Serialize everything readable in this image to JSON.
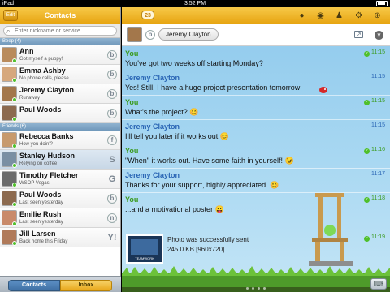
{
  "statusbar": {
    "device": "iPad",
    "time": "3:52 PM"
  },
  "sidebar": {
    "edit_label": "Edit",
    "title": "Contacts",
    "search_placeholder": "Enter nickname or service",
    "groups": [
      {
        "label": "Beep (4)",
        "contacts": [
          {
            "name": "Ann",
            "status": "Got myself a puppy!",
            "network": "b",
            "avatar_color": "#b98b5c"
          },
          {
            "name": "Emma Ashby",
            "status": "No phone calls, please",
            "network": "b",
            "avatar_color": "#d6a87d"
          },
          {
            "name": "Jeremy Clayton",
            "status": "Runaway",
            "network": "b",
            "avatar_color": "#a3774b"
          },
          {
            "name": "Paul Woods",
            "status": "",
            "network": "b",
            "avatar_color": "#8c6a4f"
          }
        ]
      },
      {
        "label": "Friends (6)",
        "contacts": [
          {
            "name": "Rebecca Banks",
            "status": "How you doin'?",
            "network": "f",
            "avatar_color": "#c79a6d"
          },
          {
            "name": "Stanley Hudson",
            "status": "Relying on coffee",
            "network": "S",
            "avatar_color": "#7a8fa3"
          },
          {
            "name": "Timothy Fletcher",
            "status": "WSOP Vegas",
            "network": "G",
            "avatar_color": "#6b6b6b"
          },
          {
            "name": "Paul Woods",
            "status": "Last seen yesterday",
            "network": "b",
            "avatar_color": "#8c6a4f"
          },
          {
            "name": "Emilie Rush",
            "status": "Last seen yesterday",
            "network": "n",
            "avatar_color": "#c98a6a"
          },
          {
            "name": "Jill Larsen",
            "status": "Back home this Friday",
            "network": "Y!",
            "avatar_color": "#b07a5a"
          }
        ]
      }
    ],
    "tabs": {
      "contacts": "Contacts",
      "inbox": "Inbox"
    }
  },
  "main": {
    "unread_count": "23",
    "icons": [
      "chat-icon",
      "record-icon",
      "person-icon",
      "gear-icon",
      "globe-icon"
    ],
    "chat": {
      "contact_name": "Jeremy Clayton",
      "network": "b",
      "messages": [
        {
          "from": "You",
          "text": "You've got two weeks off starting Monday?",
          "time": "11:15",
          "mine": true
        },
        {
          "from": "Jeremy Clayton",
          "text": "Yes! Still, I have a huge project presentation tomorrow",
          "time": "11:15",
          "mine": false
        },
        {
          "from": "You",
          "text": "What's the project? 😊",
          "time": "11:15",
          "mine": true
        },
        {
          "from": "Jeremy Clayton",
          "text": "I'll tell you later if it works out 😊",
          "time": "11:15",
          "mine": false
        },
        {
          "from": "You",
          "text": "\"When\" it works out. Have some faith in yourself! 😉",
          "time": "11:16",
          "mine": true
        },
        {
          "from": "Jeremy Clayton",
          "text": "Thanks for your support, highly appreciated. 😊",
          "time": "11:17",
          "mine": false
        },
        {
          "from": "You",
          "text": "...and a motivational poster 😛",
          "time": "11:18",
          "mine": true
        }
      ],
      "photo": {
        "status": "Photo was successfully sent",
        "size": "245.0 KB [960x720]",
        "time": "11:19",
        "caption": "TEAMWORK"
      }
    }
  },
  "colors": {
    "accent_yellow": "#f2b624",
    "you_green": "#3a9a1e",
    "them_blue": "#2a66b5",
    "online_green": "#4fbf2a"
  }
}
